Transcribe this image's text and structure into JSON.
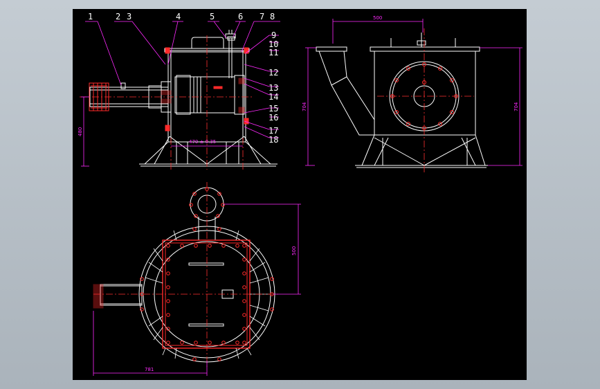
{
  "balloons": [
    "1",
    "2",
    "3",
    "4",
    "5",
    "6",
    "7",
    "8",
    "9",
    "10",
    "11",
    "12",
    "13",
    "14",
    "15",
    "16",
    "17",
    "18"
  ],
  "dims": {
    "top_width": "500",
    "side_height_left": "704",
    "side_height_right": "704",
    "front_height": "480",
    "center_span": "470 ± 0.35",
    "plan_offset": "500",
    "plan_width": "781"
  },
  "colors": {
    "line": "#ffffff",
    "flange": "#ff2a2a",
    "dimension": "#ff2aff",
    "centerline": "#ff3030",
    "background": "#000000"
  }
}
